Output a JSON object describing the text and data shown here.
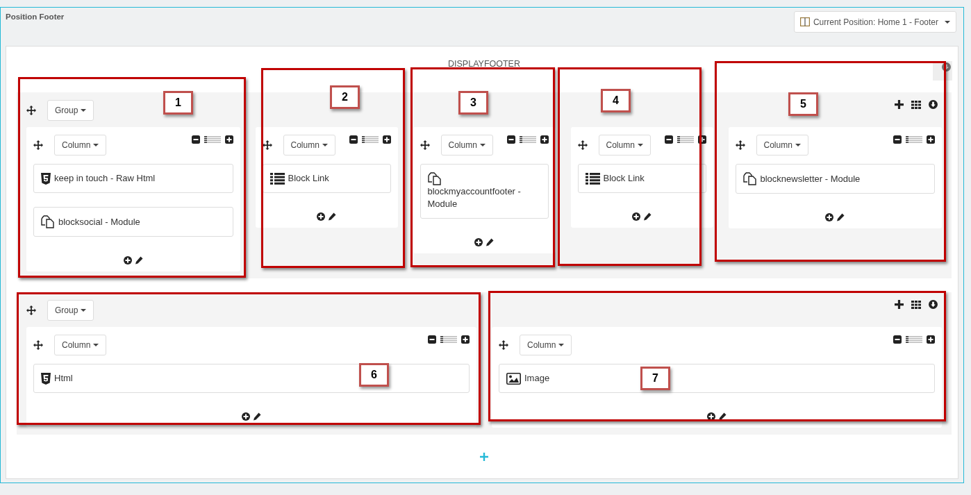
{
  "panel": {
    "title": "Position Footer",
    "position_button": "Current Position: Home 1 - Footer"
  },
  "hook": {
    "name": "DISPLAYFOOTER"
  },
  "rows": [
    {
      "group_button": "Group",
      "columns": [
        {
          "column_button": "Column",
          "modules": [
            {
              "kind": "html",
              "label": "keep in touch - Raw Html"
            },
            {
              "kind": "module",
              "label": "blocksocial - Module"
            }
          ]
        },
        {
          "column_button": "Column",
          "modules": [
            {
              "kind": "list",
              "label": "Block Link"
            }
          ]
        },
        {
          "column_button": "Column",
          "modules": [
            {
              "kind": "module",
              "label": "blockmyaccountfooter - Module"
            }
          ]
        },
        {
          "column_button": "Column",
          "modules": [
            {
              "kind": "list",
              "label": "Block Link"
            }
          ]
        },
        {
          "column_button": "Column",
          "modules": [
            {
              "kind": "module",
              "label": "blocknewsletter - Module"
            }
          ]
        }
      ]
    },
    {
      "group_button": "Group",
      "columns": [
        {
          "column_button": "Column",
          "modules": [
            {
              "kind": "html",
              "label": "Html"
            }
          ]
        },
        {
          "column_button": "Column",
          "modules": [
            {
              "kind": "image",
              "label": "Image"
            }
          ]
        }
      ]
    }
  ],
  "annotations": [
    "1",
    "2",
    "3",
    "4",
    "5",
    "6",
    "7"
  ]
}
